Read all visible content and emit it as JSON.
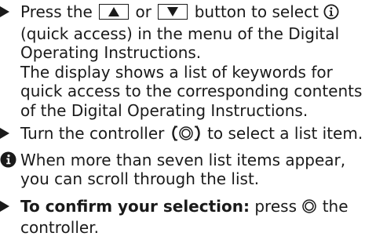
{
  "steps": {
    "step1": {
      "text_before_up": "Press the",
      "text_between": "or",
      "text_after_down": "button to select",
      "text_rest": "(quick access) in the menu of the Digital Operating Instructions.",
      "paragraph": "The display shows a list of keywords for quick access to the corresponding contents of the Digital Operating Instructions."
    },
    "step2": {
      "text_before": "Turn the controller",
      "text_after": "to select a list item."
    },
    "note": {
      "text": "When more than seven list items appear, you can scroll through the list."
    },
    "step3": {
      "strong": "To confirm your selection:",
      "text_before_icon": "press",
      "text_after_icon": "the controller."
    }
  },
  "colors": {
    "text": "#1a1a1a",
    "info_icon_fill": "#1a1a1a",
    "info_icon_glyph": "#ffffff"
  },
  "icons": {
    "bullet": "triangle-right-icon",
    "up_key": "up-arrow-key-icon",
    "down_key": "down-arrow-key-icon",
    "quick_access": "info-circle-outline-icon",
    "controller_turn": "controller-turn-icon",
    "controller_press": "controller-press-icon",
    "note": "info-circle-filled-icon"
  }
}
